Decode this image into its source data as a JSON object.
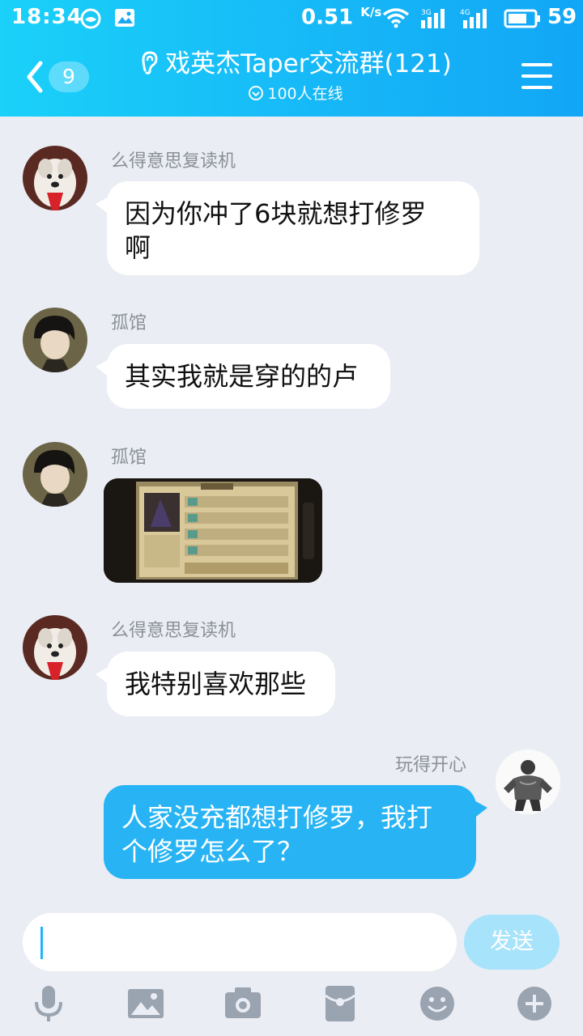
{
  "status_bar": {
    "time": "18:34",
    "speed": "0.51",
    "speed_unit": "K/s",
    "net1": "3G",
    "net2": "4G",
    "battery": "59"
  },
  "header": {
    "back_badge": "9",
    "title": "戏英杰Taper交流群(121)",
    "online": "100人在线",
    "accent": "#16b6f7"
  },
  "messages": [
    {
      "sender": "么得意思复读机",
      "text_line1": "因为你冲了6块就想打修罗",
      "text_line2": "啊"
    },
    {
      "sender": "孤馆",
      "text": "其实我就是穿的的卢"
    },
    {
      "sender": "孤馆",
      "kind": "image"
    },
    {
      "sender": "么得意思复读机",
      "text": "我特别喜欢那些"
    },
    {
      "sender": "玩得开心",
      "text_line1": "人家没充都想打修罗，我打",
      "text_line2": "个修罗怎么了？",
      "mine": true
    }
  ],
  "input": {
    "value": "",
    "send_label": "发送"
  },
  "toolbar": [
    "mic-icon",
    "image-icon",
    "camera-icon",
    "red-packet-icon",
    "emoji-icon",
    "plus-icon"
  ]
}
